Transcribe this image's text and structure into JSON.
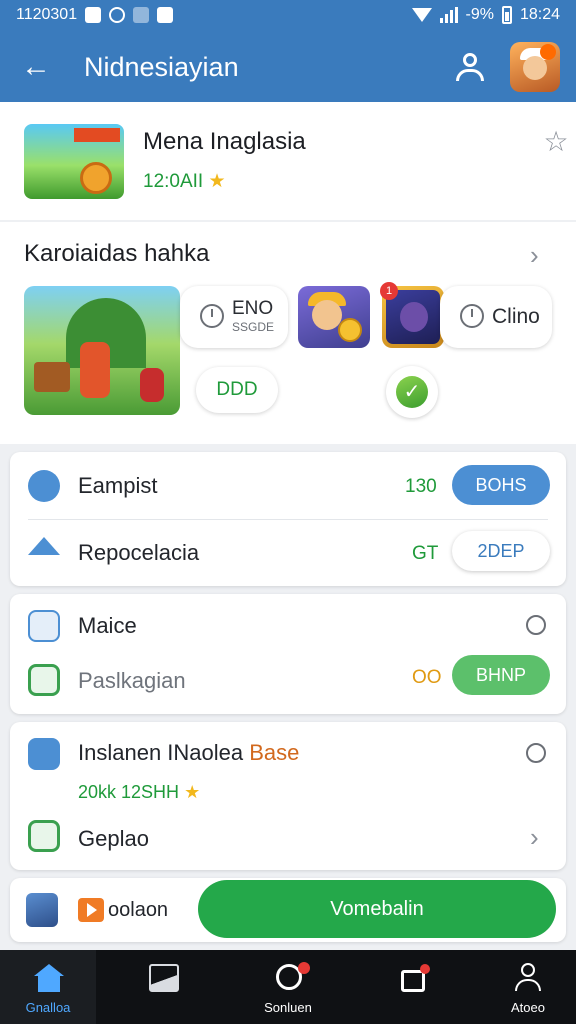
{
  "status_bar": {
    "time_left": "1120301",
    "battery": "-9%",
    "time_right": "18:24"
  },
  "app_bar": {
    "title": "Nidnesiayian"
  },
  "featured": {
    "title": "Mena Inaglasia",
    "meta": "12:0AII"
  },
  "section": {
    "title": "Karoiaidas hahka",
    "pill_1": {
      "line1": "ENO",
      "line2": "SSGDE"
    },
    "pill_2": {
      "label": "Clino"
    },
    "pill_3": {
      "label": "DDD"
    },
    "badge_count": "1"
  },
  "card_1": {
    "rows": [
      {
        "label": "Eampist",
        "value": "130",
        "button": "BOHS"
      },
      {
        "label": "Repocelacia",
        "value": "GT",
        "button": "2DEP"
      }
    ]
  },
  "card_2": {
    "rows": [
      {
        "label": "Maice"
      },
      {
        "label": "Paslkagian",
        "value": "OO",
        "button": "BHNP"
      }
    ]
  },
  "card_3": {
    "title_main": "Inslanen INaolea ",
    "title_accent": "Base",
    "meta": "20kk 12SHH",
    "row_label": "Geplao"
  },
  "bottom_bar": {
    "label": "oolaon",
    "cta": "Vomebalin"
  },
  "nav": [
    {
      "label": "Gnalloa"
    },
    {
      "label": ""
    },
    {
      "label": "Sonluen"
    },
    {
      "label": ""
    },
    {
      "label": "Atoeo"
    }
  ],
  "colors": {
    "brand": "#3a7bbd",
    "accent_green": "#24a84a",
    "value_green": "#1f9a3a",
    "value_orange": "#e09a12",
    "star": "#f2b81d"
  }
}
